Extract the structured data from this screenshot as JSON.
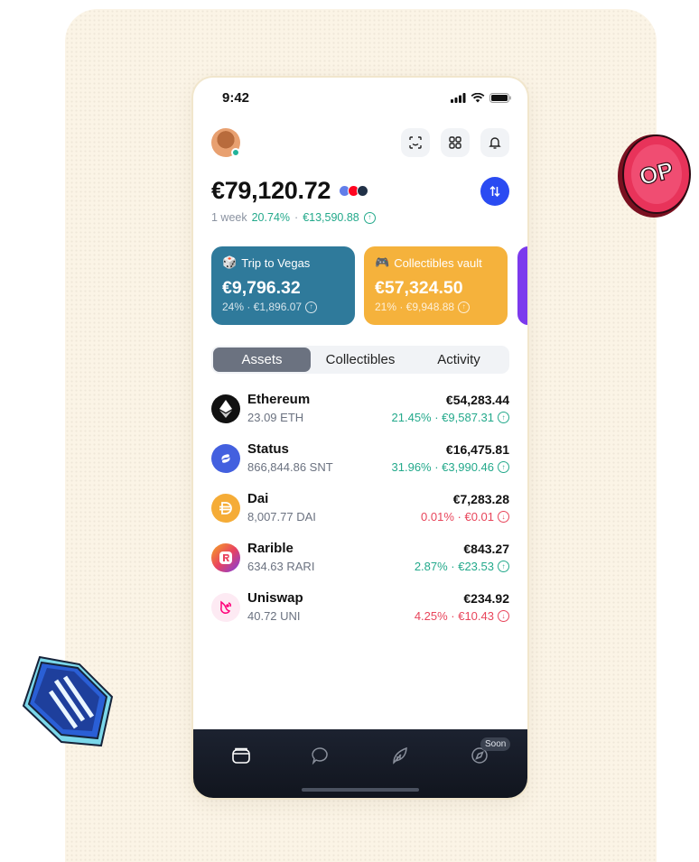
{
  "status_bar": {
    "time": "9:42"
  },
  "header": {
    "balance": "€79,120.72",
    "period": "1 week",
    "change_pct": "20.74%",
    "separator": "·",
    "change_value": "€13,590.88",
    "networks": [
      {
        "name": "ethereum",
        "color": "#627eea"
      },
      {
        "name": "optimism",
        "color": "#ff0420"
      },
      {
        "name": "arbitrum",
        "color": "#213147"
      }
    ]
  },
  "accounts": [
    {
      "name": "Trip to Vegas",
      "emoji": "🎲",
      "amount": "€9,796.32",
      "sub": "24% · €1,896.07",
      "color": "#2f7a9b"
    },
    {
      "name": "Collectibles vault",
      "emoji": "🎮",
      "amount": "€57,324.50",
      "sub": "21% · €9,948.88",
      "color": "#f5b23c"
    },
    {
      "name": "",
      "emoji": "",
      "amount": "",
      "sub": "",
      "color": "#7c3aed"
    }
  ],
  "tabs": [
    "Assets",
    "Collectibles",
    "Activity"
  ],
  "assets": [
    {
      "name": "Ethereum",
      "qty": "23.09 ETH",
      "value": "€54,283.44",
      "change": "21.45% · €9,587.31",
      "direction": "up",
      "icon": "ethereum-icon",
      "color": "#111111"
    },
    {
      "name": "Status",
      "qty": "866,844.86 SNT",
      "value": "€16,475.81",
      "change": "31.96% · €3,990.46",
      "direction": "up",
      "icon": "status-icon",
      "color": "#4360df"
    },
    {
      "name": "Dai",
      "qty": "8,007.77 DAI",
      "value": "€7,283.28",
      "change": "0.01% · €0.01",
      "direction": "down",
      "icon": "dai-icon",
      "color": "#f5ac37"
    },
    {
      "name": "Rarible",
      "qty": "634.63 RARI",
      "value": "€843.27",
      "change": "2.87% · €23.53",
      "direction": "up",
      "icon": "rarible-icon",
      "color": "#e9435f"
    },
    {
      "name": "Uniswap",
      "qty": "40.72 UNI",
      "value": "€234.92",
      "change": "4.25% · €10.43",
      "direction": "down",
      "icon": "uniswap-icon",
      "color": "#ff007a"
    }
  ],
  "bottom_nav": {
    "items": [
      "wallet-icon",
      "chat-icon",
      "feather-icon",
      "compass-icon"
    ],
    "soon_label": "Soon"
  },
  "stickers": {
    "op_text": "OP"
  },
  "colors": {
    "accent": "#2a4bf2",
    "positive": "#23a98b",
    "negative": "#e8455b"
  }
}
